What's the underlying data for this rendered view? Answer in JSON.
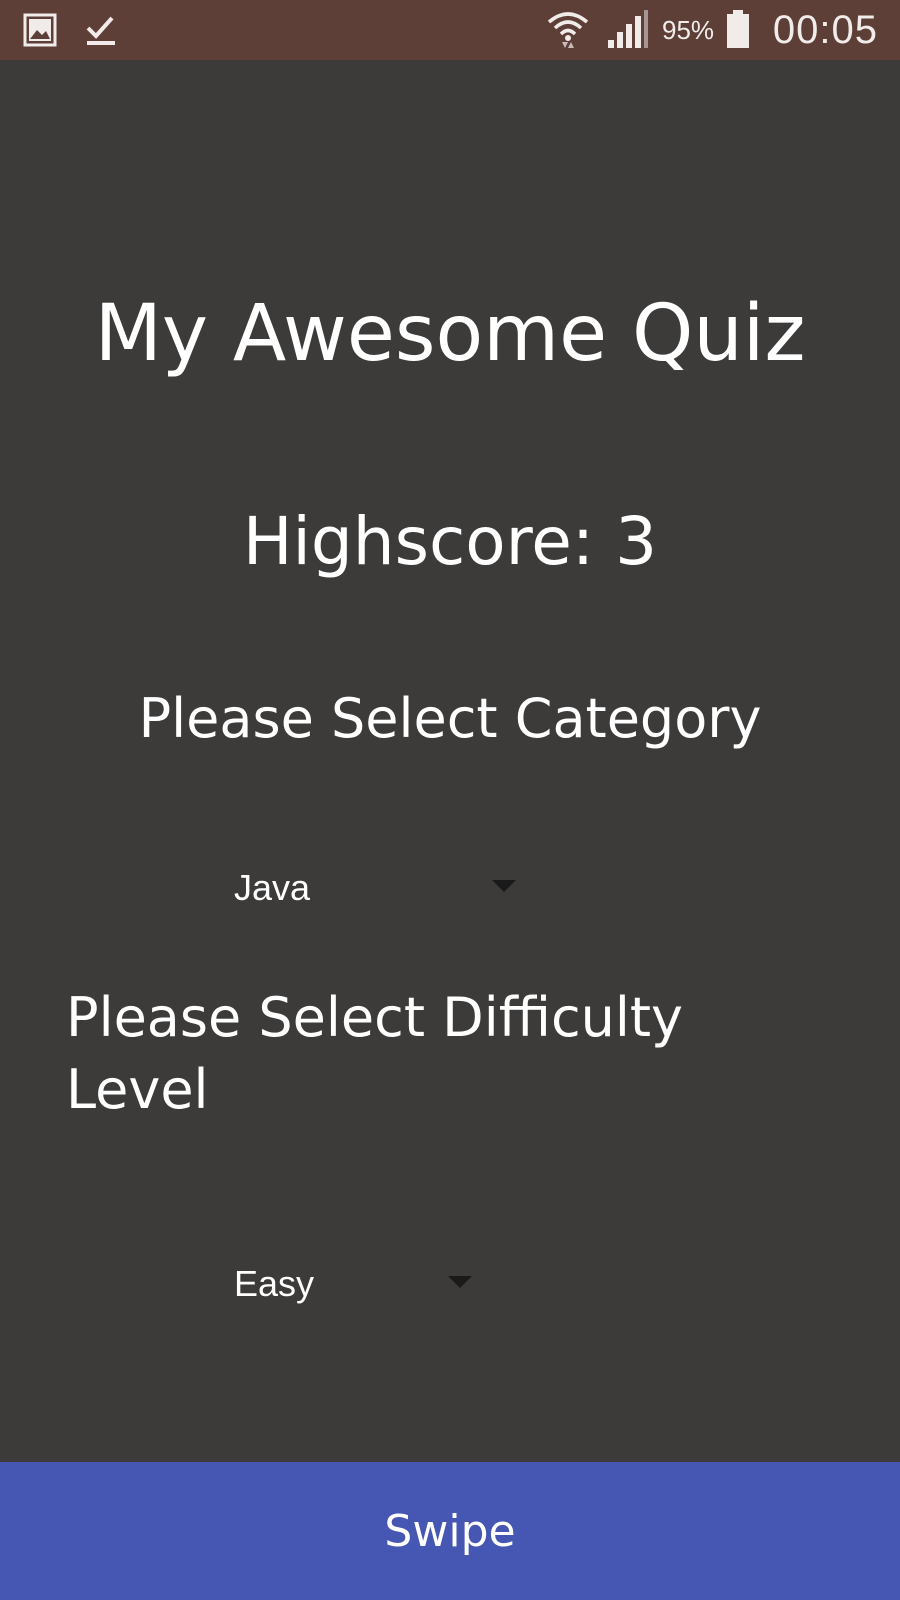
{
  "status_bar": {
    "icons": [
      "gallery-icon",
      "checkmark-icon",
      "wifi-icon",
      "signal-icon",
      "battery-icon"
    ],
    "battery_percent": "95%",
    "time": "00:05",
    "background_color": "#5d3f38"
  },
  "main": {
    "title": "My Awesome Quiz",
    "highscore": "Highscore: 3",
    "category_prompt": "Please Select Category",
    "category_selected": "Java",
    "difficulty_prompt": "Please Select Difficulty Level",
    "difficulty_selected": "Easy",
    "background_color": "#3c3b3a"
  },
  "footer": {
    "button_label": "Swipe",
    "button_color": "#4656b3"
  }
}
